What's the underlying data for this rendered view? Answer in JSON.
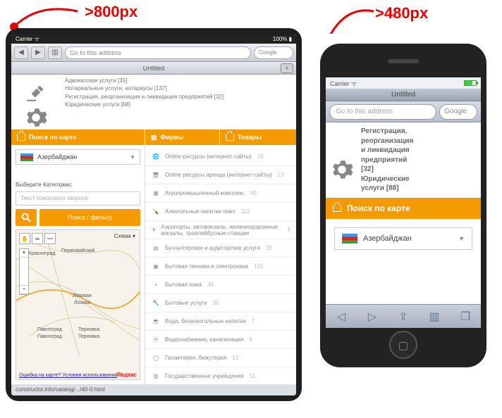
{
  "labels": {
    "tablet": ">800px",
    "phone": ">480px"
  },
  "tablet": {
    "status": {
      "carrier": "Carrier ᯤ",
      "time": "",
      "battery": "100% ▮"
    },
    "nav": {
      "address_placeholder": "Go to this address",
      "search_placeholder": "Google"
    },
    "title": "Untitled",
    "top_categories": [
      "Адвокатские услуги [35]",
      "Нотариальные услуги, нотариусы [137]",
      "Регистрация, реорганизация и ликвидация предприятий [32]",
      "Юридические услуги [88]"
    ],
    "orange_tabs": {
      "map": "Поиск по карте",
      "firms": "Фирмы",
      "goods": "Товары"
    },
    "country": "Азербайджан",
    "category_label": "Выберите Категорию:",
    "search_placeholder": "Текст поискового запроса",
    "filter_button": "Поиск / фильтр",
    "map": {
      "schema": "Схема ▾",
      "cities": [
        "Красноград",
        "Первомайский",
        "Лозовая",
        "Лозова",
        "Павлоград",
        "Павлоград",
        "Терновка",
        "Терновка"
      ],
      "link": "Ошибка на карте?  Условия использования",
      "yandex": "Яндекс"
    },
    "list": [
      {
        "icon": "globe",
        "text": "Online-ресурсы (интернет-сайты)",
        "count": "15"
      },
      {
        "icon": "monitor",
        "text": "Online ресурсы аренда (интернет-сайты)",
        "count": "23"
      },
      {
        "icon": "tractor",
        "text": "Агропромышленный комплекс",
        "count": "45"
      },
      {
        "icon": "bottle",
        "text": "Алкогольные напитки пиво",
        "count": "112"
      },
      {
        "icon": "plane",
        "text": "Аэропорты, автовокзалы, железнодорожные вокзалы, троллейбусные станции",
        "count": "4"
      },
      {
        "icon": "doc",
        "text": "Бухгалтерские и аудиторские услуги",
        "count": "33"
      },
      {
        "icon": "tv",
        "text": "Бытовая техника и электроника",
        "count": "105"
      },
      {
        "icon": "shoe",
        "text": "Бытовая кожа",
        "count": "34"
      },
      {
        "icon": "wrench",
        "text": "Бытовые услуги",
        "count": "30"
      },
      {
        "icon": "cup",
        "text": "Вода, безалкогольные напитки",
        "count": "7"
      },
      {
        "icon": "pipe",
        "text": "Водоснабжение, канализация",
        "count": "9"
      },
      {
        "icon": "ring",
        "text": "Галантерея, бижутерия",
        "count": "13"
      },
      {
        "icon": "building",
        "text": "Государственные учреждения",
        "count": "51"
      }
    ],
    "footer": "constructor.info/catalog/.../40-0.html"
  },
  "phone": {
    "status": {
      "carrier": "Carrier"
    },
    "title": "Untitled",
    "nav": {
      "address_placeholder": "Go to this address",
      "search_placeholder": "Google"
    },
    "categories": [
      "Регистрация,",
      "реорганизация",
      "и ликвидация",
      "предприятий",
      "[32]",
      "Юридические",
      "услуги [88]"
    ],
    "orange": "Поиск по карте",
    "country": "Азербайджан"
  }
}
